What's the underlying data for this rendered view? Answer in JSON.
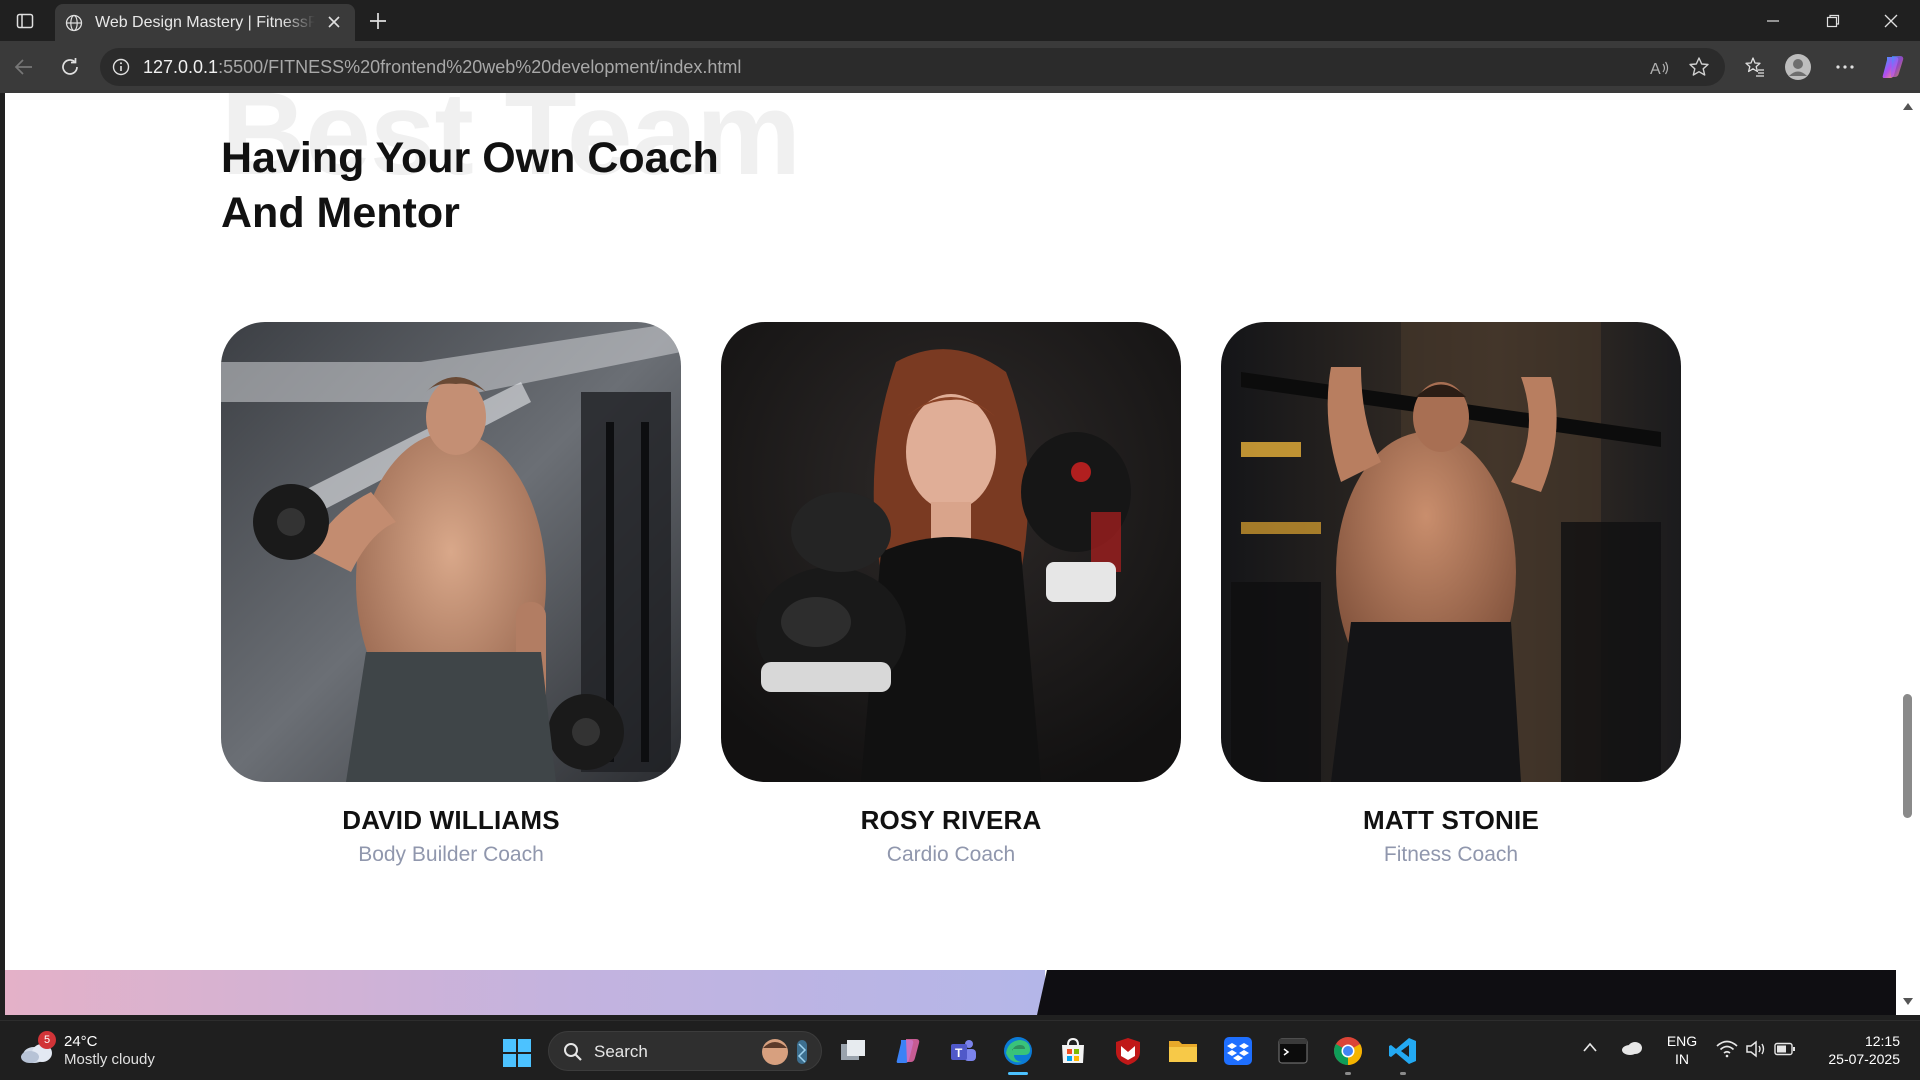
{
  "browser": {
    "tab_title": "Web Design Mastery | FitnessPoint",
    "url_host": "127.0.0.1",
    "url_rest": ":5500/FITNESS%20frontend%20web%20development/index.html"
  },
  "page": {
    "bg_word": "Best Team",
    "heading_line1": "Having Your Own Coach",
    "heading_line2": "And Mentor",
    "coaches": [
      {
        "name": "DAVID WILLIAMS",
        "role": "Body Builder Coach"
      },
      {
        "name": "ROSY RIVERA",
        "role": "Cardio Coach"
      },
      {
        "name": "MATT STONIE",
        "role": "Fitness Coach"
      }
    ]
  },
  "taskbar": {
    "weather_badge": "5",
    "temperature": "24°C",
    "condition": "Mostly cloudy",
    "search_label": "Search",
    "lang_line1": "ENG",
    "lang_line2": "IN",
    "time": "12:15",
    "date": "25-07-2025"
  },
  "colors": {
    "accent": "#4cc2ff",
    "role_text": "#9097ad",
    "heading_text": "#111111"
  }
}
